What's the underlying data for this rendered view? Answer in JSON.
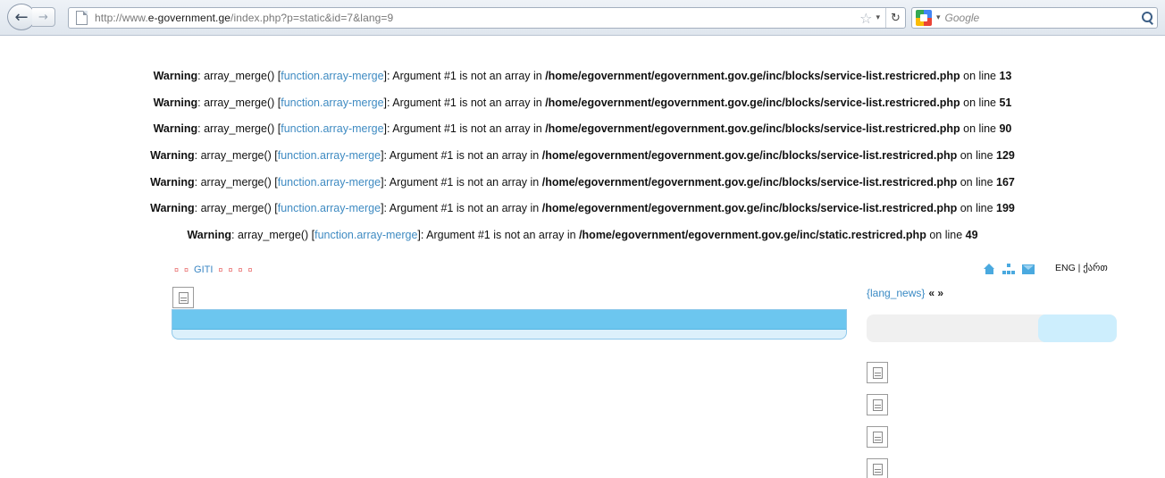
{
  "browser": {
    "url_prefix": "http://www.",
    "url_host": "e-government.ge",
    "url_path": "/index.php?p=static&id=7&lang=9",
    "search_placeholder": "Google",
    "icons": {
      "back": "back-arrow-icon",
      "forward": "forward-arrow-icon",
      "page": "page-icon",
      "bookmark": "star-icon",
      "reload": "reload-icon",
      "search_engine": "google-icon",
      "search": "magnifier-icon"
    }
  },
  "warnings": [
    {
      "label": "Warning",
      "func": "array_merge() [",
      "link": "function.array-merge",
      "msg": "]: Argument #1 is not an array in ",
      "path": "/home/egovernment/egovernment.gov.ge/inc/blocks/service-list.restricred.php",
      "online": " on line ",
      "line": "13"
    },
    {
      "label": "Warning",
      "func": "array_merge() [",
      "link": "function.array-merge",
      "msg": "]: Argument #1 is not an array in ",
      "path": "/home/egovernment/egovernment.gov.ge/inc/blocks/service-list.restricred.php",
      "online": " on line ",
      "line": "51"
    },
    {
      "label": "Warning",
      "func": "array_merge() [",
      "link": "function.array-merge",
      "msg": "]: Argument #1 is not an array in ",
      "path": "/home/egovernment/egovernment.gov.ge/inc/blocks/service-list.restricred.php",
      "online": " on line ",
      "line": "90"
    },
    {
      "label": "Warning",
      "func": "array_merge() [",
      "link": "function.array-merge",
      "msg": "]: Argument #1 is not an array in ",
      "path": "/home/egovernment/egovernment.gov.ge/inc/blocks/service-list.restricred.php",
      "online": " on line ",
      "line": "129"
    },
    {
      "label": "Warning",
      "func": "array_merge() [",
      "link": "function.array-merge",
      "msg": "]: Argument #1 is not an array in ",
      "path": "/home/egovernment/egovernment.gov.ge/inc/blocks/service-list.restricred.php",
      "online": " on line ",
      "line": "167"
    },
    {
      "label": "Warning",
      "func": "array_merge() [",
      "link": "function.array-merge",
      "msg": "]: Argument #1 is not an array in ",
      "path": "/home/egovernment/egovernment.gov.ge/inc/blocks/service-list.restricred.php",
      "online": " on line ",
      "line": "199"
    },
    {
      "label": "Warning",
      "func": "array_merge() [",
      "link": "function.array-merge",
      "msg": "]: Argument #1 is not an array in ",
      "path": "/home/egovernment/egovernment.gov.ge/inc/static.restricred.php",
      "online": " on line ",
      "line": "49"
    }
  ],
  "topnav": {
    "bullet": "¤",
    "link": "GITI"
  },
  "lang": {
    "eng": "ENG",
    "sep": " | ",
    "geo": "ქართ"
  },
  "news": {
    "heading": "{lang_news}",
    "arrows": "« »"
  },
  "colors": {
    "link_blue": "#3f8bc2",
    "bar_blue": "#6cc6ef",
    "bullet_red": "#e86a6a",
    "icon_blue": "#4aa9df"
  }
}
